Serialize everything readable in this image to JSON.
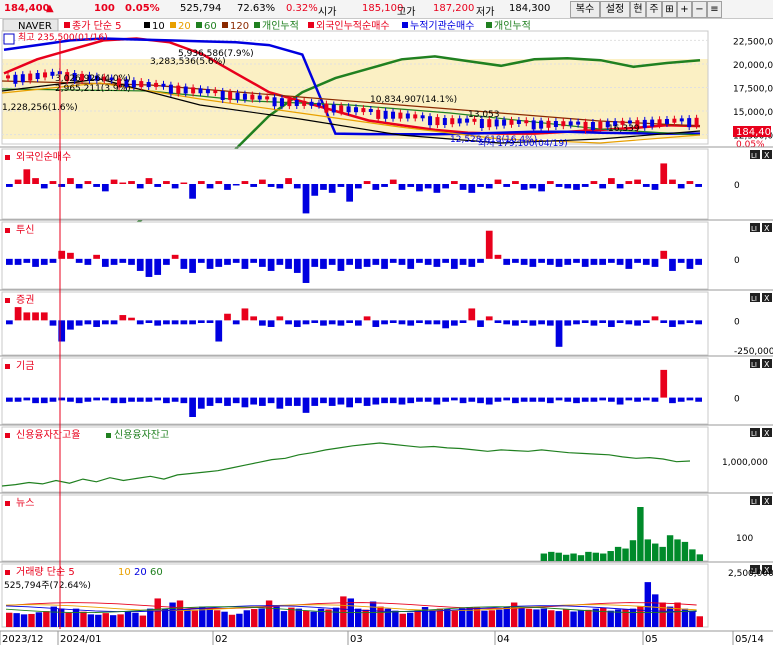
{
  "header": {
    "price": "184,400",
    "arrow": "▲",
    "change": "100",
    "change_pct": "0.05%",
    "volume": "525,794",
    "vol_ratio": "72.63%",
    "open_pct": "0.32%",
    "open_label": "시가",
    "open": "185,100",
    "high_label": "고가",
    "high": "187,200",
    "low_label": "저가",
    "low": "184,300",
    "buttons": [
      "복수",
      "설정",
      "현",
      "주"
    ]
  },
  "main_panel": {
    "stock_name": "NAVER",
    "legend": [
      {
        "text": "종가 단순 5",
        "color": "#e8001c"
      },
      {
        "text": "10",
        "color": "#000000"
      },
      {
        "text": "20",
        "color": "#e8a000"
      },
      {
        "text": "60",
        "color": "#208020"
      },
      {
        "text": "120",
        "color": "#8b2a00"
      },
      {
        "text": "개인누적",
        "color": "#208020"
      },
      {
        "text": "외국인누적순매수",
        "color": "#e8001c"
      },
      {
        "text": "누적기관순매수",
        "color": "#0000e0"
      },
      {
        "text": "개인누적",
        "color": "#208020"
      }
    ],
    "annotations": [
      "최고 235,500(01/16)",
      "5,936,586(7.9%)",
      "3,283,536(5.6%)",
      "3,026,926(4.0%)",
      "2,965,211(3.9%)",
      "1,228,256(1.6%)",
      "10,834,907(14.1%)",
      "13,053",
      "16,339",
      "12,528,618(16.4%)",
      "최저 179,100(04/19)"
    ],
    "y_ticks": [
      "22,500,000",
      "20,000,000",
      "17,500,000",
      "15,000,000",
      "12,500,000"
    ],
    "price_tag": "184,400",
    "pct_tag": "0.05%"
  },
  "sub_panels": [
    {
      "title": "외국인순매수",
      "ticks": [
        "0"
      ]
    },
    {
      "title": "투신",
      "ticks": [
        "0"
      ]
    },
    {
      "title": "증권",
      "ticks": [
        "0",
        "-250,000"
      ]
    },
    {
      "title": "기금",
      "ticks": [
        "0"
      ]
    },
    {
      "title": "신용융자잔고율",
      "title2": "신용융자잔고",
      "ticks": [
        "1,000,000"
      ]
    },
    {
      "title": "뉴스",
      "ticks": [
        "100"
      ]
    },
    {
      "title": "거래량 단순 5",
      "legend_tail": [
        "10",
        "20",
        "60"
      ],
      "volume_label": "525,794주(72.64%)",
      "ticks": [
        "2,500,000"
      ]
    }
  ],
  "panel_buttons": [
    "LI",
    "X"
  ],
  "x_axis": [
    "2023/12",
    "2024/01",
    "02",
    "03",
    "04",
    "05",
    "05/14"
  ],
  "colors": {
    "up": "#e8001c",
    "down": "#0000e0",
    "ma60": "#208020",
    "ma120": "#8b2a00",
    "ma20": "#e8a000",
    "ma10": "#000000"
  },
  "chart_data": [
    {
      "type": "line",
      "title": "NAVER",
      "description_series": [
        "개인누적",
        "외국인누적순매수",
        "누적기관순매수"
      ],
      "ylim": [
        11500000,
        23500000
      ],
      "series": [
        {
          "name": "개인누적",
          "values": [
            1228256,
            1500000,
            1800000,
            2400000,
            3100000,
            5500000,
            8000000,
            11000000,
            14500000,
            17000000,
            18500000,
            19500000,
            20500000,
            20800000,
            20300000,
            19800000,
            20500000,
            20600000,
            20400000,
            19700000,
            20100000,
            20400000
          ]
        },
        {
          "name": "외국인누적순매수",
          "values": [
            19000000,
            20500000,
            21500000,
            22500000,
            22700000,
            22300000,
            21000000,
            19000000,
            17000000,
            16000000,
            15000000,
            14000000,
            13500000,
            13000000,
            12700000,
            12600000,
            12600000,
            12800000,
            13000000,
            13200000,
            13500000,
            13400000
          ]
        },
        {
          "name": "누적기관순매수",
          "values": [
            21500000,
            22000000,
            22500000,
            22700000,
            22600000,
            22500000,
            22400000,
            22300000,
            22000000,
            21000000,
            12600000,
            12550000,
            12530000,
            12528618,
            12600000,
            12700000,
            12800000,
            12800000,
            12700000,
            12650000,
            12600000,
            12600000
          ]
        }
      ]
    },
    {
      "type": "bar",
      "title": "외국인순매수",
      "values": [
        -2,
        3,
        10,
        4,
        -3,
        2,
        -2,
        4,
        -3,
        2,
        -2,
        -5,
        3,
        1,
        2,
        -3,
        4,
        -2,
        2,
        -3,
        1,
        -10,
        2,
        -3,
        2,
        -4,
        -1,
        2,
        -2,
        3,
        -2,
        -3,
        4,
        -3,
        -20,
        -8,
        -4,
        -6,
        -2,
        -12,
        -3,
        2,
        -4,
        -2,
        3,
        -4,
        -2,
        -5,
        -3,
        -6,
        -3,
        2,
        -4,
        -6,
        -2,
        -3,
        3,
        -2,
        2,
        -4,
        -3,
        -5,
        2,
        -2,
        -3,
        -4,
        -2,
        2,
        -3,
        4,
        -3,
        2,
        3,
        -2,
        -4,
        14,
        3,
        -3,
        2,
        -2
      ]
    },
    {
      "type": "bar",
      "title": "투신",
      "values": [
        -3,
        -3,
        -2,
        -4,
        -3,
        -2,
        4,
        3,
        -2,
        -3,
        2,
        -4,
        -3,
        -2,
        -3,
        -6,
        -9,
        -8,
        -3,
        2,
        -5,
        -7,
        -2,
        -5,
        -4,
        -3,
        -2,
        -5,
        -2,
        -4,
        -6,
        -3,
        -5,
        -7,
        -12,
        -4,
        -5,
        -3,
        -6,
        -3,
        -5,
        -4,
        -3,
        -5,
        -2,
        -3,
        -5,
        -2,
        -3,
        -4,
        -2,
        -5,
        -3,
        -4,
        -2,
        14,
        2,
        -3,
        -2,
        -3,
        -4,
        -2,
        -3,
        -4,
        -3,
        -2,
        -4,
        -3,
        -3,
        -2,
        -3,
        -5,
        -2,
        -3,
        -4,
        4,
        -6,
        -2,
        -5,
        -3
      ]
    },
    {
      "type": "bar",
      "title": "증권",
      "values": [
        -3,
        10,
        6,
        6,
        6,
        -4,
        -16,
        -7,
        -4,
        -3,
        -5,
        -3,
        -3,
        4,
        2,
        -3,
        -2,
        -4,
        -3,
        -3,
        -3,
        -3,
        -2,
        -2,
        -16,
        5,
        -3,
        9,
        3,
        -4,
        -5,
        3,
        -3,
        -5,
        -3,
        -2,
        -4,
        -3,
        -4,
        -2,
        -4,
        3,
        -5,
        -3,
        -2,
        -3,
        -4,
        -2,
        -3,
        -3,
        -6,
        -4,
        -2,
        9,
        -5,
        3,
        -2,
        -3,
        -4,
        -2,
        -4,
        -3,
        -4,
        -20,
        -4,
        -3,
        -2,
        -4,
        -2,
        -5,
        -2,
        -3,
        -4,
        -2,
        3,
        -2,
        -5,
        -3,
        -2,
        -3
      ]
    },
    {
      "type": "bar",
      "title": "기금",
      "values": [
        -3,
        -3,
        -2,
        -4,
        -4,
        -3,
        -2,
        -3,
        -4,
        -3,
        -2,
        -2,
        -4,
        -4,
        -3,
        -3,
        -3,
        -2,
        -4,
        -3,
        -4,
        -14,
        -8,
        -6,
        -4,
        -6,
        -4,
        -7,
        -5,
        -6,
        -4,
        -8,
        -6,
        -6,
        -11,
        -6,
        -4,
        -6,
        -5,
        -7,
        -4,
        -6,
        -5,
        -4,
        -4,
        -5,
        -4,
        -3,
        -3,
        -5,
        -3,
        -2,
        -4,
        -3,
        -4,
        -5,
        -3,
        -2,
        -4,
        -3,
        -3,
        -3,
        -4,
        -2,
        -3,
        -4,
        -3,
        -3,
        -2,
        -3,
        -5,
        -2,
        -3,
        -2,
        -3,
        20,
        -4,
        -3,
        -2,
        -3
      ]
    },
    {
      "type": "line",
      "title": "신용융자잔고율",
      "values": [
        100,
        102,
        105,
        103,
        108,
        104,
        110,
        106,
        112,
        108,
        111,
        114,
        110,
        116,
        118,
        120,
        122,
        126,
        130,
        134,
        138,
        140,
        145,
        148,
        152,
        155,
        158,
        160,
        162,
        160,
        158,
        156,
        157,
        155,
        154,
        152,
        150,
        152,
        151,
        150,
        152,
        150,
        148,
        147,
        146,
        145,
        142,
        140,
        141,
        139,
        135,
        136
      ]
    },
    {
      "type": "bar",
      "title": "뉴스",
      "values": [
        0,
        0,
        0,
        0,
        0,
        0,
        0,
        0,
        0,
        0,
        0,
        0,
        0,
        0,
        0,
        0,
        0,
        0,
        0,
        0,
        0,
        0,
        0,
        0,
        0,
        0,
        0,
        0,
        0,
        0,
        0,
        0,
        0,
        0,
        0,
        0,
        0,
        0,
        0,
        0,
        0,
        0,
        0,
        0,
        0,
        0,
        0,
        0,
        0,
        0,
        0,
        0,
        0,
        0,
        0,
        0,
        0,
        0,
        0,
        0,
        0,
        0,
        0,
        0,
        0,
        0,
        0,
        0,
        0,
        0,
        0,
        0,
        18,
        22,
        20,
        15,
        18,
        14,
        22,
        20,
        18,
        24,
        34,
        30,
        50,
        130,
        52,
        42,
        34,
        62,
        52,
        46,
        28,
        16
      ]
    },
    {
      "type": "bar",
      "title": "거래량 단순 5",
      "values": [
        700000,
        680000,
        620000,
        640000,
        720000,
        780000,
        1000000,
        900000,
        700000,
        900000,
        750000,
        620000,
        600000,
        680000,
        580000,
        620000,
        780000,
        700000,
        560000,
        900000,
        1400000,
        900000,
        1200000,
        1300000,
        850000,
        800000,
        1000000,
        900000,
        820000,
        750000,
        600000,
        650000,
        820000,
        880000,
        900000,
        1300000,
        1000000,
        780000,
        950000,
        900000,
        800000,
        750000,
        900000,
        860000,
        950000,
        1500000,
        1400000,
        900000,
        850000,
        1250000,
        1000000,
        900000,
        800000,
        650000,
        700000,
        820000,
        980000,
        860000,
        900000,
        880000,
        840000,
        920000,
        980000,
        950000,
        800000,
        820000,
        850000,
        1000000,
        1200000,
        920000,
        890000,
        860000,
        900000,
        820000,
        780000,
        880000,
        760000,
        820000,
        840000,
        900000,
        950000,
        800000,
        860000,
        880000,
        900000,
        1000000,
        2200000,
        1600000,
        1200000,
        1000000,
        1200000,
        900000,
        800000,
        525794
      ]
    }
  ]
}
